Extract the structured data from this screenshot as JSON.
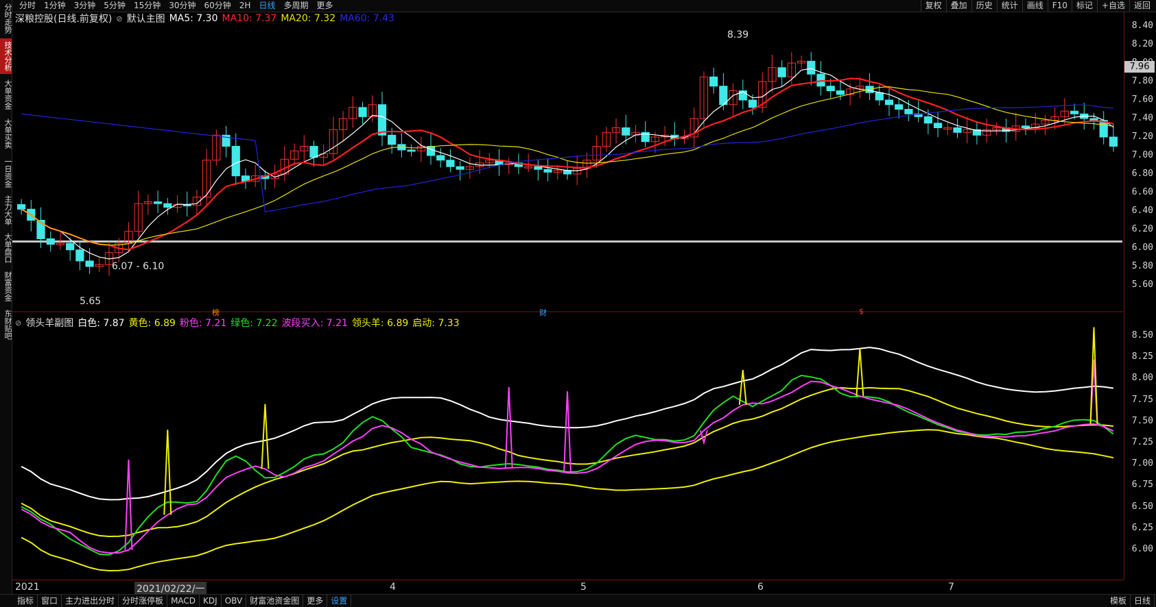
{
  "top_tabs": [
    "分时",
    "1分钟",
    "3分钟",
    "5分钟",
    "15分钟",
    "30分钟",
    "60分钟",
    "2H",
    "日线",
    "多周期",
    "更多"
  ],
  "active_tab": "日线",
  "right_tabs": [
    "复权",
    "叠加",
    "历史",
    "统计",
    "画线",
    "F10",
    "标记",
    "+自选",
    "返回"
  ],
  "sidebar": [
    "分时走势",
    "技术分析",
    "大单资金",
    "大单买卖",
    "一日资金",
    "主力大单",
    "大单盘口",
    "财富资金",
    "东财贴吧"
  ],
  "main": {
    "stock_title": "深粮控股(日线.前复权)",
    "chart_label": "默认主图",
    "ma5": "MA5: 7.30",
    "ma10": "MA10: 7.37",
    "ma20": "MA20: 7.32",
    "ma60": "MA60: 7.43",
    "annot_high": "8.39",
    "annot_low": "5.65",
    "annot_range": "6.07 - 6.10",
    "current_price": "7.96",
    "marker_bang": "榜",
    "marker_cai": "财",
    "marker_s": "$"
  },
  "sub": {
    "title": "领头羊副图",
    "white": "白色: 7.87",
    "yellow": "黄色: 6.89",
    "pink": "粉色: 7.21",
    "green": "绿色: 7.22",
    "buy": "波段买入: 7.21",
    "leader": "领头羊: 6.89",
    "start": "启动: 7.33"
  },
  "price_axis": [
    "8.40",
    "8.20",
    "8.00",
    "7.80",
    "7.60",
    "7.40",
    "7.20",
    "7.00",
    "6.80",
    "6.60",
    "6.40",
    "6.20",
    "6.00",
    "5.80",
    "5.60"
  ],
  "sub_axis": [
    "8.50",
    "8.25",
    "8.00",
    "7.75",
    "7.50",
    "7.25",
    "7.00",
    "6.75",
    "6.50",
    "6.25",
    "6.00"
  ],
  "x_axis": [
    "2021",
    "2021/02/22/一",
    "4",
    "5",
    "6",
    "7"
  ],
  "bottom_tabs": [
    "指标",
    "窗口",
    "主力进出分时",
    "分时涨停板",
    "MACD",
    "KDJ",
    "OBV",
    "财富池资金图",
    "更多",
    "设置"
  ],
  "bottom_right": [
    "模板",
    "日线"
  ],
  "colors": {
    "up": "#ff3030",
    "down": "#40e8e8",
    "ma5": "#ffffff",
    "ma10": "#ff2020",
    "ma20": "#e8e000",
    "ma60": "#2222dd",
    "pink": "#ff40ff",
    "green": "#20e020",
    "yellow": "#f0f000"
  }
}
